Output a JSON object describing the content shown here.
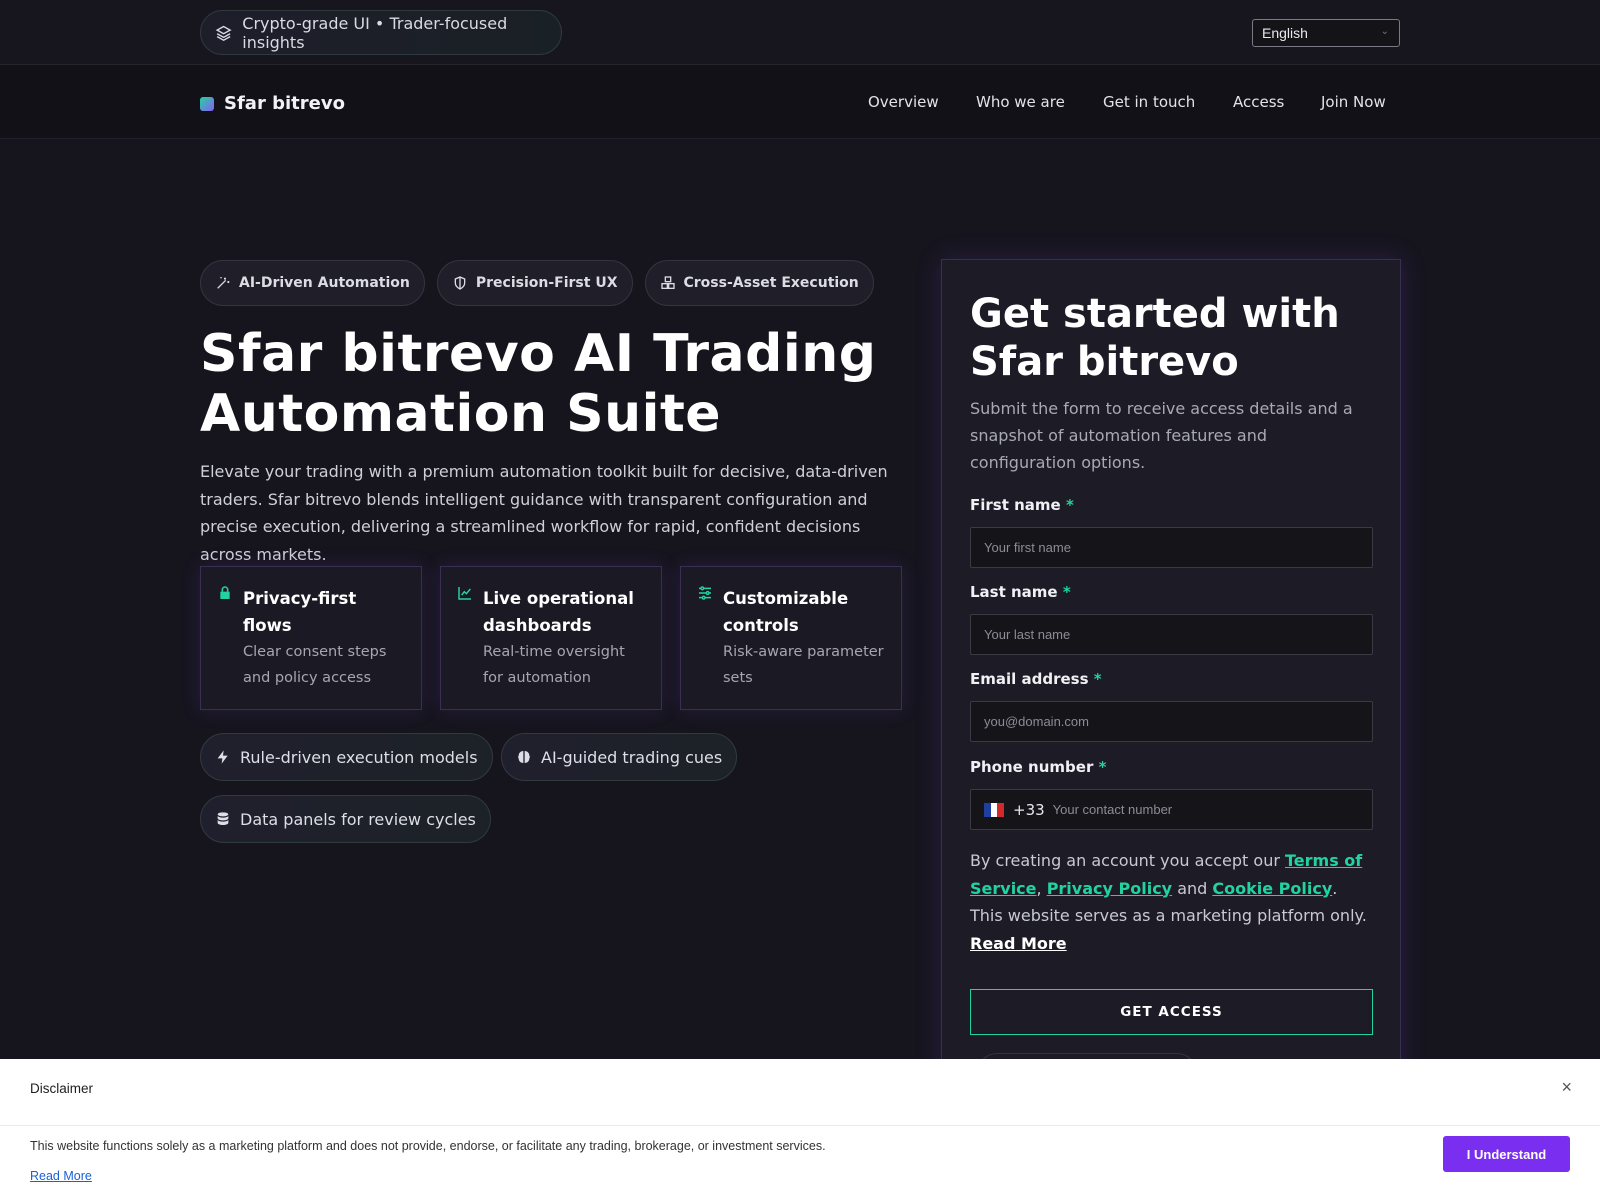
{
  "topbar": {
    "pill_text": "Crypto-grade UI • Trader-focused insights",
    "language": "English"
  },
  "nav": {
    "brand": "Sfar bitrevo",
    "links": [
      "Overview",
      "Who we are",
      "Get in touch",
      "Access",
      "Join Now"
    ]
  },
  "hero": {
    "chips": [
      "AI-Driven Automation",
      "Precision-First UX",
      "Cross-Asset Execution"
    ],
    "title": "Sfar bitrevo AI Trading Automation Suite",
    "description": "Elevate your trading with a premium automation toolkit built for decisive, data-driven traders. Sfar bitrevo blends intelligent guidance with transparent configuration and precise execution, delivering a streamlined workflow for rapid, confident decisions across markets.",
    "cards": [
      {
        "title": "Privacy-first flows",
        "text": "Clear consent steps and policy access",
        "icon": "lock-icon"
      },
      {
        "title": "Live operational dashboards",
        "text": "Real-time oversight for automation",
        "icon": "chart-line-icon"
      },
      {
        "title": "Customizable controls",
        "text": "Risk-aware parameter sets",
        "icon": "sliders-icon"
      }
    ],
    "tags": [
      "Rule-driven execution models",
      "AI-guided trading cues",
      "Data panels for review cycles"
    ]
  },
  "form": {
    "title": "Get started with Sfar bitrevo",
    "subtitle": "Submit the form to receive access details and a snapshot of automation features and configuration options.",
    "first_name_label": "First name",
    "first_name_placeholder": "Your first name",
    "last_name_label": "Last name",
    "last_name_placeholder": "Your last name",
    "email_label": "Email address",
    "email_placeholder": "you@domain.com",
    "phone_label": "Phone number",
    "phone_code": "+33",
    "phone_placeholder": "Your contact number",
    "required_mark": "*",
    "terms_prefix": "By creating an account you accept our ",
    "terms_link": "Terms of Service",
    "terms_sep": ", ",
    "privacy_link": "Privacy Policy",
    "terms_and": " and ",
    "cookie_link": "Cookie Policy",
    "terms_suffix": ". This website serves as a marketing platform only. ",
    "read_more": "Read More",
    "cta": "GET ACCESS"
  },
  "disclaimer": {
    "title": "Disclaimer",
    "close": "×",
    "text": "This website functions solely as a marketing platform and does not provide, endorse, or facilitate any trading, brokerage, or investment services.",
    "read_more": "Read More",
    "button": "I Understand"
  },
  "colors": {
    "accent_green": "#22d3a0",
    "accent_purple": "#7a2ff0",
    "background": "#16151e"
  }
}
